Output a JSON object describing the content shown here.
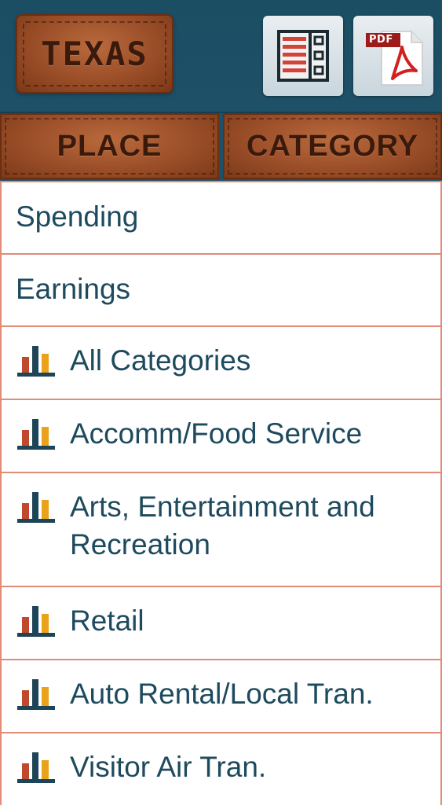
{
  "header": {
    "logo_text": "TEXAS",
    "table_button": {
      "icon": "table-icon"
    },
    "pdf_button": {
      "icon": "pdf-icon",
      "badge": "PDF"
    }
  },
  "segments": [
    {
      "label": "PLACE"
    },
    {
      "label": "CATEGORY"
    }
  ],
  "list": {
    "plain_items": [
      {
        "label": "Spending"
      },
      {
        "label": "Earnings"
      }
    ],
    "category_items": [
      {
        "label": "All Categories",
        "icon": "bar-chart-icon"
      },
      {
        "label": "Accomm/Food Service",
        "icon": "bar-chart-icon"
      },
      {
        "label": "Arts, Entertainment and Recreation",
        "icon": "bar-chart-icon"
      },
      {
        "label": "Retail",
        "icon": "bar-chart-icon"
      },
      {
        "label": "Auto Rental/Local Tran.",
        "icon": "bar-chart-icon"
      },
      {
        "label": "Visitor Air Tran.",
        "icon": "bar-chart-icon"
      }
    ]
  },
  "colors": {
    "header_bg": "#1e5068",
    "leather": "#9a4e28",
    "row_border": "#e08c77",
    "text": "#1e4a5e",
    "icon_red": "#c0482c",
    "icon_orange": "#e9a21a",
    "icon_navy": "#1d4457"
  }
}
